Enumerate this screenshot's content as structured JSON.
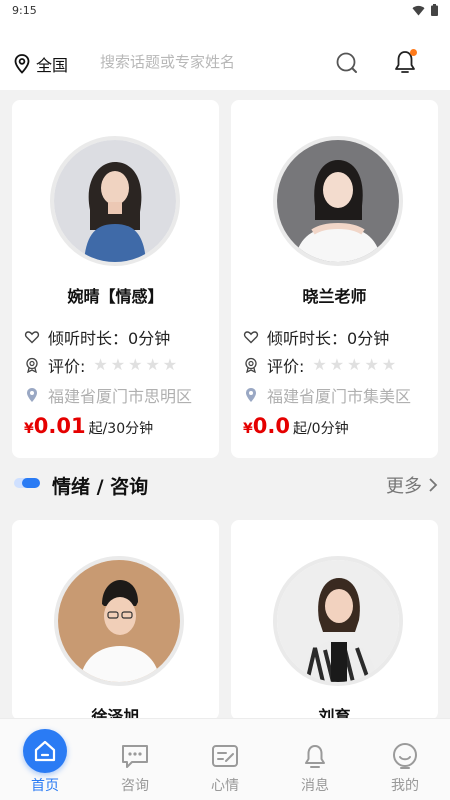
{
  "status": {
    "time": "9:15"
  },
  "header": {
    "location": "全国",
    "search_placeholder": "搜索话题或专家姓名"
  },
  "colors": {
    "accent": "#2a7bf4",
    "price": "#e50000",
    "badge": "#ff7a1a"
  },
  "experts_top": [
    {
      "name": "婉晴【情感】",
      "listen_label": "倾听时长：",
      "listen_value": "0分钟",
      "rating_label": "评价:",
      "rating_stars": 0,
      "location": "福建省厦门市思明区",
      "currency": "¥",
      "price": "0.01",
      "price_unit": "起/30分钟"
    },
    {
      "name": "晓兰老师",
      "listen_label": "倾听时长：",
      "listen_value": "0分钟",
      "rating_label": "评价:",
      "rating_stars": 0,
      "location": "福建省厦门市集美区",
      "currency": "¥",
      "price": "0.0",
      "price_unit": "起/0分钟"
    }
  ],
  "section": {
    "title": "情绪 / 咨询",
    "more": "更多"
  },
  "experts_bottom": [
    {
      "name": "徐泽旭"
    },
    {
      "name": "刘育"
    }
  ],
  "tabbar": [
    {
      "label": "首页",
      "icon": "home-icon",
      "active": true
    },
    {
      "label": "咨询",
      "icon": "chat-icon",
      "active": false
    },
    {
      "label": "心情",
      "icon": "mood-note-icon",
      "active": false
    },
    {
      "label": "消息",
      "icon": "bell-icon",
      "active": false
    },
    {
      "label": "我的",
      "icon": "profile-icon",
      "active": false
    }
  ]
}
